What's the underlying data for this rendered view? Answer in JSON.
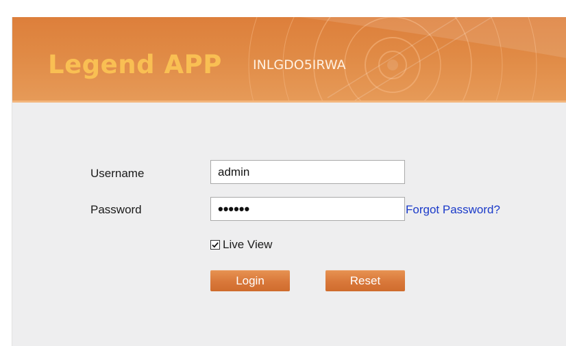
{
  "banner": {
    "brand": "Legend APP",
    "device_name": "INLGDO5IRWA"
  },
  "login_form": {
    "username_label": "Username",
    "username_value": "admin",
    "password_label": "Password",
    "password_masked": "••••••",
    "forgot_password_link": "Forgot Password?",
    "live_view_label": "Live View",
    "live_view_checked": true,
    "login_button": "Login",
    "reset_button": "Reset"
  },
  "colors": {
    "banner_orange": "#dd7f3b",
    "brand_yellow": "#f9bf53",
    "button_orange": "#d9783a",
    "link_blue": "#1a3ac9",
    "panel_gray": "#eeeeef"
  }
}
